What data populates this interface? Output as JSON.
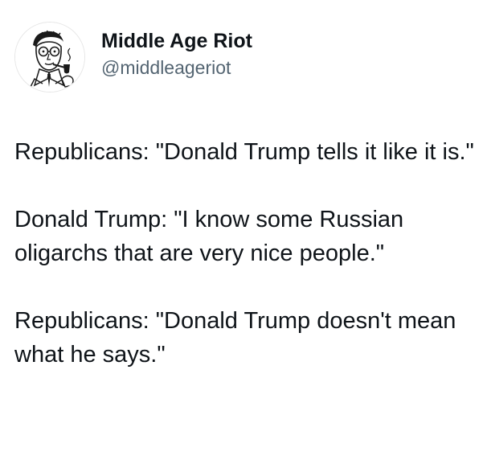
{
  "author": {
    "display_name": "Middle Age Riot",
    "handle": "@middleageriot",
    "avatar_icon": "vintage-man-smoking-pipe-illustration"
  },
  "post": {
    "paragraphs": [
      "Republicans: \"Donald Trump tells it like it is.\"",
      "Donald Trump: \"I know some Russian oligarchs that are very nice people.\"",
      "Republicans: \"Donald Trump doesn't mean what he says.\""
    ]
  },
  "colors": {
    "text": "#0f1419",
    "secondary_text": "#536471",
    "background": "#ffffff"
  }
}
